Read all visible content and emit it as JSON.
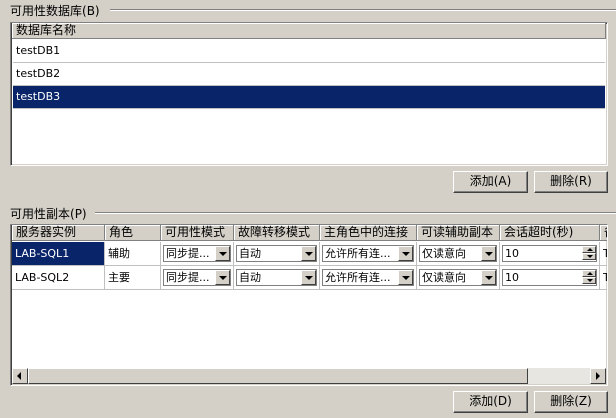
{
  "databases_group": {
    "label": "可用性数据库",
    "accel": "(B)",
    "column_header": "数据库名称",
    "rows": [
      "testDB1",
      "testDB2",
      "testDB3"
    ],
    "selected_index": 2
  },
  "db_buttons": {
    "add": "添加(A)",
    "remove": "删除(R)"
  },
  "replicas_group": {
    "label": "可用性副本",
    "accel": "(P)",
    "columns": [
      "服务器实例",
      "角色",
      "可用性模式",
      "故障转移模式",
      "主角色中的连接",
      "可读辅助副本",
      "会话超时(秒)",
      "备"
    ],
    "rows": [
      {
        "server": "LAB-SQL1",
        "role": "辅助",
        "mode": "同步提...",
        "failover": "自动",
        "primary_conn": "允许所有连...",
        "readable": "仅读意向",
        "timeout": "10",
        "backup": "T"
      },
      {
        "server": "LAB-SQL2",
        "role": "主要",
        "mode": "同步提...",
        "failover": "自动",
        "primary_conn": "允许所有连...",
        "readable": "仅读意向",
        "timeout": "10",
        "backup": "T"
      }
    ]
  },
  "replica_buttons": {
    "add": "添加(D)",
    "remove": "删除(Z)"
  },
  "colors": {
    "face": "#d4d0c8",
    "selection": "#0a246a",
    "shadow": "#808080",
    "window": "#ffffff"
  }
}
